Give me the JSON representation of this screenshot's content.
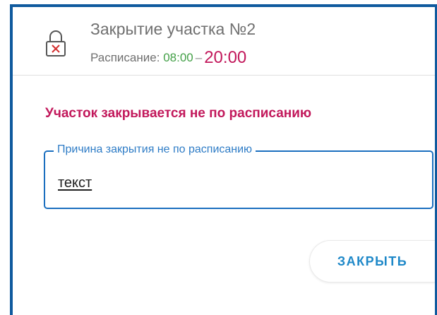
{
  "header": {
    "title": "Закрытие участка №2",
    "schedule_label": "Расписание:",
    "schedule_start": "08:00",
    "schedule_separator": "–",
    "schedule_end": "20:00",
    "icon": "lock-closed-icon"
  },
  "warning": {
    "text": "Участок закрывается не по расписанию"
  },
  "reason_field": {
    "label": "Причина закрытия не по расписанию",
    "value": "текст"
  },
  "actions": {
    "close_label": "ЗАКРЫТЬ"
  },
  "colors": {
    "frame": "#0f5a9e",
    "accent": "#1e88c8",
    "warning": "#c2185b",
    "start_time": "#43a047"
  }
}
